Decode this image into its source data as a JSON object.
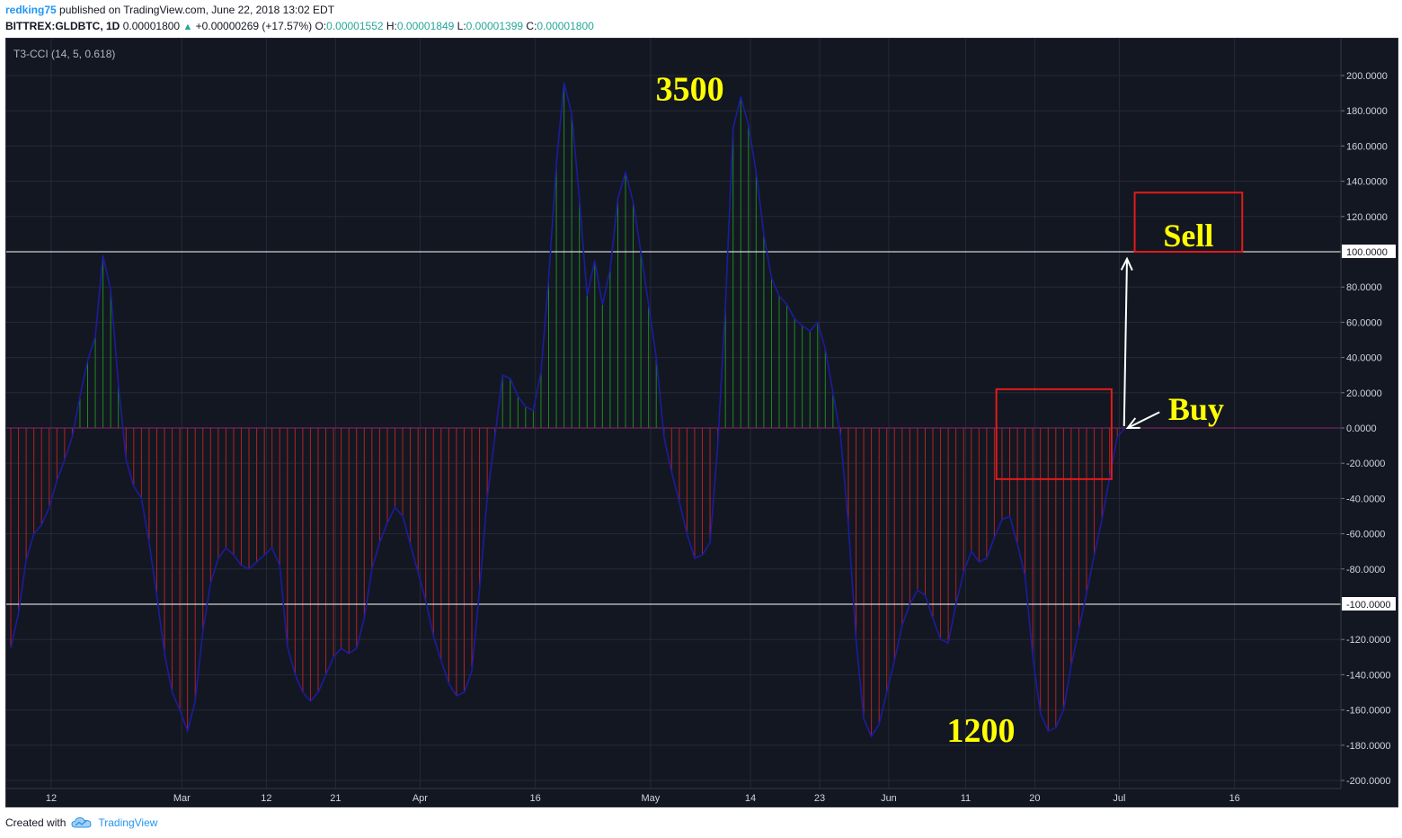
{
  "header": {
    "user": "redking75",
    "published": "published on TradingView.com, June 22, 2018 13:02 EDT",
    "symbol": "BITTREX:GLDBTC, 1D",
    "price": "0.00001800",
    "change_arrow": "▲",
    "change": "+0.00000269 (+17.57%)",
    "o_label": "O:",
    "o_value": "0.00001552",
    "h_label": "H:",
    "h_value": "0.00001849",
    "l_label": "L:",
    "l_value": "0.00001399",
    "c_label": "C:",
    "c_value": "0.00001800"
  },
  "indicator": {
    "name": "T3-CCI (14, 5, 0.618)"
  },
  "footer": {
    "created_with": "Created with",
    "brand": "TradingView",
    "brand_icon": "tradingview-cloud-icon"
  },
  "colors": {
    "background": "#131722",
    "positive": "#1f8a1f",
    "negative": "#b22222",
    "line": "#1c1c9e",
    "annotation_text": "#ffff00",
    "annotation_box": "#e01b1b",
    "arrow": "#ffffff",
    "level_line": "#ffffff"
  },
  "chart_data": {
    "type": "line",
    "title": "T3-CCI (14, 5, 0.618)",
    "xlabel": "",
    "ylabel": "",
    "ylim": [
      -200,
      200
    ],
    "yticks": [
      "200.0000",
      "180.0000",
      "160.0000",
      "140.0000",
      "120.0000",
      "100.0000",
      "80.0000",
      "60.0000",
      "40.0000",
      "20.0000",
      "0.0000",
      "-20.0000",
      "-40.0000",
      "-60.0000",
      "-80.0000",
      "-100.0000",
      "-120.0000",
      "-140.0000",
      "-160.0000",
      "-180.0000",
      "-200.0000"
    ],
    "highlight_levels": [
      "100.0000",
      "-100.0000"
    ],
    "xticks": [
      {
        "label": "12",
        "date": "2018-02-12"
      },
      {
        "label": "Mar",
        "date": "2018-03-01"
      },
      {
        "label": "12",
        "date": "2018-03-12"
      },
      {
        "label": "21",
        "date": "2018-03-21"
      },
      {
        "label": "Apr",
        "date": "2018-04-01"
      },
      {
        "label": "16",
        "date": "2018-04-16"
      },
      {
        "label": "May",
        "date": "2018-05-01"
      },
      {
        "label": "14",
        "date": "2018-05-14"
      },
      {
        "label": "23",
        "date": "2018-05-23"
      },
      {
        "label": "Jun",
        "date": "2018-06-01"
      },
      {
        "label": "11",
        "date": "2018-06-11"
      },
      {
        "label": "20",
        "date": "2018-06-20"
      },
      {
        "label": "Jul",
        "date": "2018-07-01"
      },
      {
        "label": "16",
        "date": "2018-07-16"
      }
    ],
    "grid": true,
    "series": [
      {
        "values": [
          -125,
          -105,
          -75,
          -60,
          -55,
          -45,
          -30,
          -18,
          -5,
          18,
          38,
          52,
          98,
          78,
          25,
          -18,
          -33,
          -40,
          -65,
          -95,
          -128,
          -150,
          -160,
          -172,
          -155,
          -115,
          -88,
          -74,
          -68,
          -72,
          -78,
          -80,
          -76,
          -72,
          -68,
          -78,
          -124,
          -140,
          -150,
          -155,
          -150,
          -140,
          -130,
          -125,
          -128,
          -125,
          -108,
          -80,
          -65,
          -54,
          -45,
          -50,
          -66,
          -82,
          -98,
          -118,
          -132,
          -145,
          -152,
          -150,
          -138,
          -92,
          -40,
          -5,
          30,
          28,
          18,
          12,
          10,
          32,
          85,
          150,
          196,
          178,
          130,
          75,
          95,
          70,
          90,
          130,
          145,
          128,
          100,
          70,
          40,
          -5,
          -25,
          -42,
          -60,
          -74,
          -72,
          -65,
          -10,
          70,
          170,
          188,
          172,
          145,
          110,
          85,
          75,
          70,
          62,
          58,
          55,
          60,
          45,
          20,
          -5,
          -55,
          -120,
          -165,
          -175,
          -168,
          -150,
          -132,
          -112,
          -100,
          -92,
          -95,
          -108,
          -120,
          -122,
          -100,
          -82,
          -70,
          -76,
          -74,
          -62,
          -52,
          -50,
          -66,
          -84,
          -130,
          -162,
          -172,
          -170,
          -160,
          -135,
          -114,
          -94,
          -72,
          -52,
          -28,
          -5,
          0
        ]
      }
    ],
    "annotations": [
      {
        "text": "3500",
        "type": "label",
        "anchor_value": 190
      },
      {
        "text": "Sell",
        "type": "box",
        "value_range": [
          100,
          130
        ]
      },
      {
        "text": "Buy",
        "type": "box",
        "value_range": [
          -29,
          22
        ]
      },
      {
        "text": "1200",
        "type": "label",
        "anchor_value": -172
      }
    ]
  }
}
